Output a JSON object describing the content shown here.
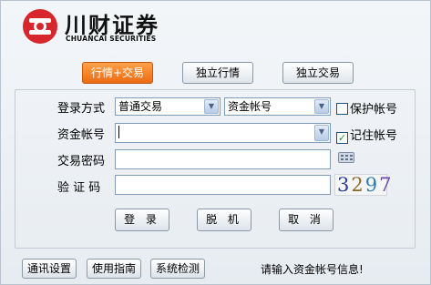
{
  "logo": {
    "name_cn": "川财证券",
    "name_en": "CHUANCAI SECURITIES"
  },
  "tabs": [
    {
      "label": "行情+交易",
      "active": true
    },
    {
      "label": "独立行情",
      "active": false
    },
    {
      "label": "独立交易",
      "active": false
    }
  ],
  "form": {
    "login_mode_label": "登录方式",
    "login_mode_value": "普通交易",
    "account_type_value": "资金帐号",
    "protect_account_label": "保护帐号",
    "protect_account_checked": false,
    "account_label": "资金帐号",
    "account_value": "",
    "remember_account_label": "记住帐号",
    "remember_account_checked": true,
    "password_label": "交易密码",
    "password_value": "",
    "captcha_label": "验 证 码",
    "captcha_value": "",
    "captcha_image_text": "3297"
  },
  "actions": {
    "login": "登 录",
    "offline": "脱 机",
    "cancel": "取 消"
  },
  "footer": {
    "comm_settings": "通讯设置",
    "user_guide": "使用指南",
    "system_check": "系统检测",
    "status_text": "请输入资金帐号信息!"
  },
  "colors": {
    "brand_red": "#d8262d",
    "active_tab": "#ee6a10",
    "checkmark": "#2a8a2a"
  },
  "icons": {
    "dropdown": "chevron-down-icon",
    "keyboard": "keyboard-icon",
    "check": "checkmark-icon"
  }
}
